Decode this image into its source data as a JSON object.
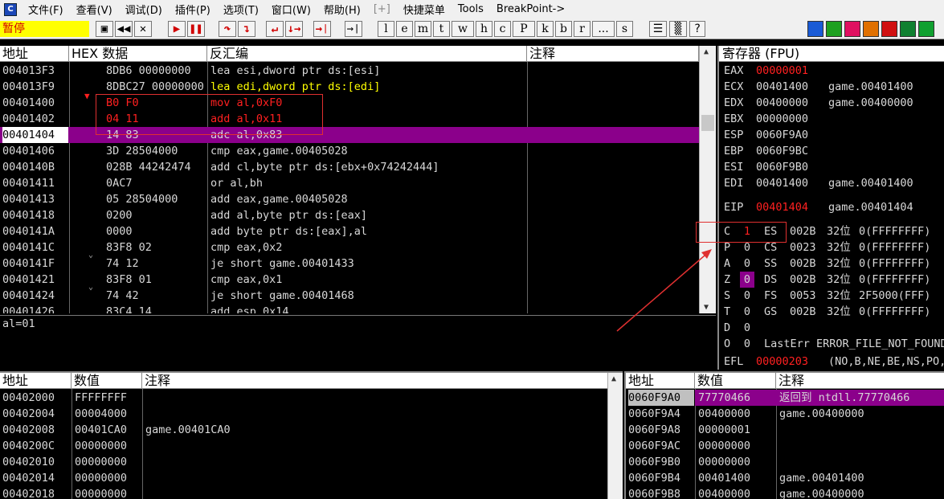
{
  "menu": {
    "app_icon": "C",
    "items": [
      "文件(F)",
      "查看(V)",
      "调试(D)",
      "插件(P)",
      "选项(T)",
      "窗口(W)",
      "帮助(H)",
      "[+]",
      "快捷菜单",
      "Tools",
      "BreakPoint->"
    ]
  },
  "toolbar": {
    "status": "暂停",
    "buttons": [
      "▣",
      "◀◀",
      "✕",
      "▶",
      "❚❚",
      "↷",
      "↴",
      "↵",
      "↓→",
      "→❘",
      "l",
      "e",
      "m",
      "t",
      "w",
      "h",
      "c",
      "P",
      "k",
      "b",
      "r",
      "...",
      "s",
      "☰",
      "▒",
      "?"
    ],
    "color_buttons": [
      "#1a5bd6",
      "#1ea020",
      "#e01060",
      "#e07000",
      "#d01010",
      "#108030",
      "#10a030"
    ]
  },
  "disasm": {
    "headers": [
      "地址",
      "HEX 数据",
      "反汇编",
      "注释"
    ],
    "rows": [
      {
        "addr": "004013F3",
        "hex": "8DB6 00000000",
        "asm": "lea esi,dword ptr ds:[esi]",
        "comment": ""
      },
      {
        "addr": "004013F9",
        "hex": "8DBC27 00000000",
        "asm": "lea edi,dword ptr ds:[edi]",
        "comment": ""
      },
      {
        "addr": "00401400",
        "hex": "B0 F0",
        "asm": "mov al,0xF0",
        "comment": ""
      },
      {
        "addr": "00401402",
        "hex": "04 11",
        "asm": "add al,0x11",
        "comment": ""
      },
      {
        "addr": "00401404",
        "hex": "14 83",
        "asm": "adc al,0x83",
        "comment": ""
      },
      {
        "addr": "00401406",
        "hex": "3D 28504000",
        "asm": "cmp eax,game.00405028",
        "comment": ""
      },
      {
        "addr": "0040140B",
        "hex": "028B 44242474",
        "asm": "add cl,byte ptr ds:[ebx+0x74242444]",
        "comment": ""
      },
      {
        "addr": "00401411",
        "hex": "0AC7",
        "asm": "or al,bh",
        "comment": ""
      },
      {
        "addr": "00401413",
        "hex": "05 28504000",
        "asm": "add eax,game.00405028",
        "comment": ""
      },
      {
        "addr": "00401418",
        "hex": "0200",
        "asm": "add al,byte ptr ds:[eax]",
        "comment": ""
      },
      {
        "addr": "0040141A",
        "hex": "0000",
        "asm": "add byte ptr ds:[eax],al",
        "comment": ""
      },
      {
        "addr": "0040141C",
        "hex": "83F8 02",
        "asm": "cmp eax,0x2",
        "comment": ""
      },
      {
        "addr": "0040141F",
        "hex": "74 12",
        "asm": "je short game.00401433",
        "comment": ""
      },
      {
        "addr": "00401421",
        "hex": "83F8 01",
        "asm": "cmp eax,0x1",
        "comment": ""
      },
      {
        "addr": "00401424",
        "hex": "74 42",
        "asm": "je short game.00401468",
        "comment": ""
      },
      {
        "addr": "00401426",
        "hex": "83C4 14",
        "asm": "add esp,0x14",
        "comment": ""
      }
    ],
    "info": "al=01"
  },
  "registers": {
    "header": "寄存器 (FPU)",
    "regs": [
      {
        "name": "EAX",
        "value": "00000001",
        "comment": ""
      },
      {
        "name": "ECX",
        "value": "00401400",
        "comment": "game.00401400"
      },
      {
        "name": "EDX",
        "value": "00400000",
        "comment": "game.00400000"
      },
      {
        "name": "EBX",
        "value": "00000000",
        "comment": ""
      },
      {
        "name": "ESP",
        "value": "0060F9A0",
        "comment": ""
      },
      {
        "name": "EBP",
        "value": "0060F9BC",
        "comment": ""
      },
      {
        "name": "ESI",
        "value": "0060F9B0",
        "comment": ""
      },
      {
        "name": "EDI",
        "value": "00401400",
        "comment": "game.00401400"
      }
    ],
    "eip": {
      "name": "EIP",
      "value": "00401404",
      "comment": "game.00401404"
    },
    "flags": [
      {
        "flag": "C",
        "val": "1",
        "seg": "ES",
        "sel": "002B",
        "bits": "32位",
        "base": "0(FFFFFFFF)"
      },
      {
        "flag": "P",
        "val": "0",
        "seg": "CS",
        "sel": "0023",
        "bits": "32位",
        "base": "0(FFFFFFFF)"
      },
      {
        "flag": "A",
        "val": "0",
        "seg": "SS",
        "sel": "002B",
        "bits": "32位",
        "base": "0(FFFFFFFF)"
      },
      {
        "flag": "Z",
        "val": "0",
        "seg": "DS",
        "sel": "002B",
        "bits": "32位",
        "base": "0(FFFFFFFF)"
      },
      {
        "flag": "S",
        "val": "0",
        "seg": "FS",
        "sel": "0053",
        "bits": "32位",
        "base": "2F5000(FFF)"
      },
      {
        "flag": "T",
        "val": "0",
        "seg": "GS",
        "sel": "002B",
        "bits": "32位",
        "base": "0(FFFFFFFF)"
      },
      {
        "flag": "D",
        "val": "0",
        "seg": "",
        "sel": "",
        "bits": "",
        "base": ""
      },
      {
        "flag": "O",
        "val": "0",
        "seg": "LastErr",
        "sel": "ERROR_FILE_NOT_FOUND",
        "bits": "",
        "base": ""
      }
    ],
    "efl": {
      "name": "EFL",
      "value": "00000203",
      "comment": "(NO,B,NE,BE,NS,PO,GE,G)"
    }
  },
  "dump": {
    "headers": [
      "地址",
      "数值",
      "注释"
    ],
    "rows": [
      {
        "addr": "00402000",
        "val": "FFFFFFFF",
        "comment": ""
      },
      {
        "addr": "00402004",
        "val": "00004000",
        "comment": ""
      },
      {
        "addr": "00402008",
        "val": "00401CA0",
        "comment": "game.00401CA0"
      },
      {
        "addr": "0040200C",
        "val": "00000000",
        "comment": ""
      },
      {
        "addr": "00402010",
        "val": "00000000",
        "comment": ""
      },
      {
        "addr": "00402014",
        "val": "00000000",
        "comment": ""
      },
      {
        "addr": "00402018",
        "val": "00000000",
        "comment": ""
      }
    ]
  },
  "stack": {
    "headers": [
      "地址",
      "数值",
      "注释"
    ],
    "rows": [
      {
        "addr": "0060F9A0",
        "val": "77770466",
        "comment": "返回到 ntdll.77770466"
      },
      {
        "addr": "0060F9A4",
        "val": "00400000",
        "comment": "game.00400000"
      },
      {
        "addr": "0060F9A8",
        "val": "00000001",
        "comment": ""
      },
      {
        "addr": "0060F9AC",
        "val": "00000000",
        "comment": ""
      },
      {
        "addr": "0060F9B0",
        "val": "00000000",
        "comment": ""
      },
      {
        "addr": "0060F9B4",
        "val": "00401400",
        "comment": "game.00401400"
      },
      {
        "addr": "0060F9B8",
        "val": "00400000",
        "comment": "game.00400000"
      }
    ]
  },
  "colors": {
    "highlight": "#8b008b",
    "red": "#ff2020",
    "annotation": "#e03030"
  }
}
